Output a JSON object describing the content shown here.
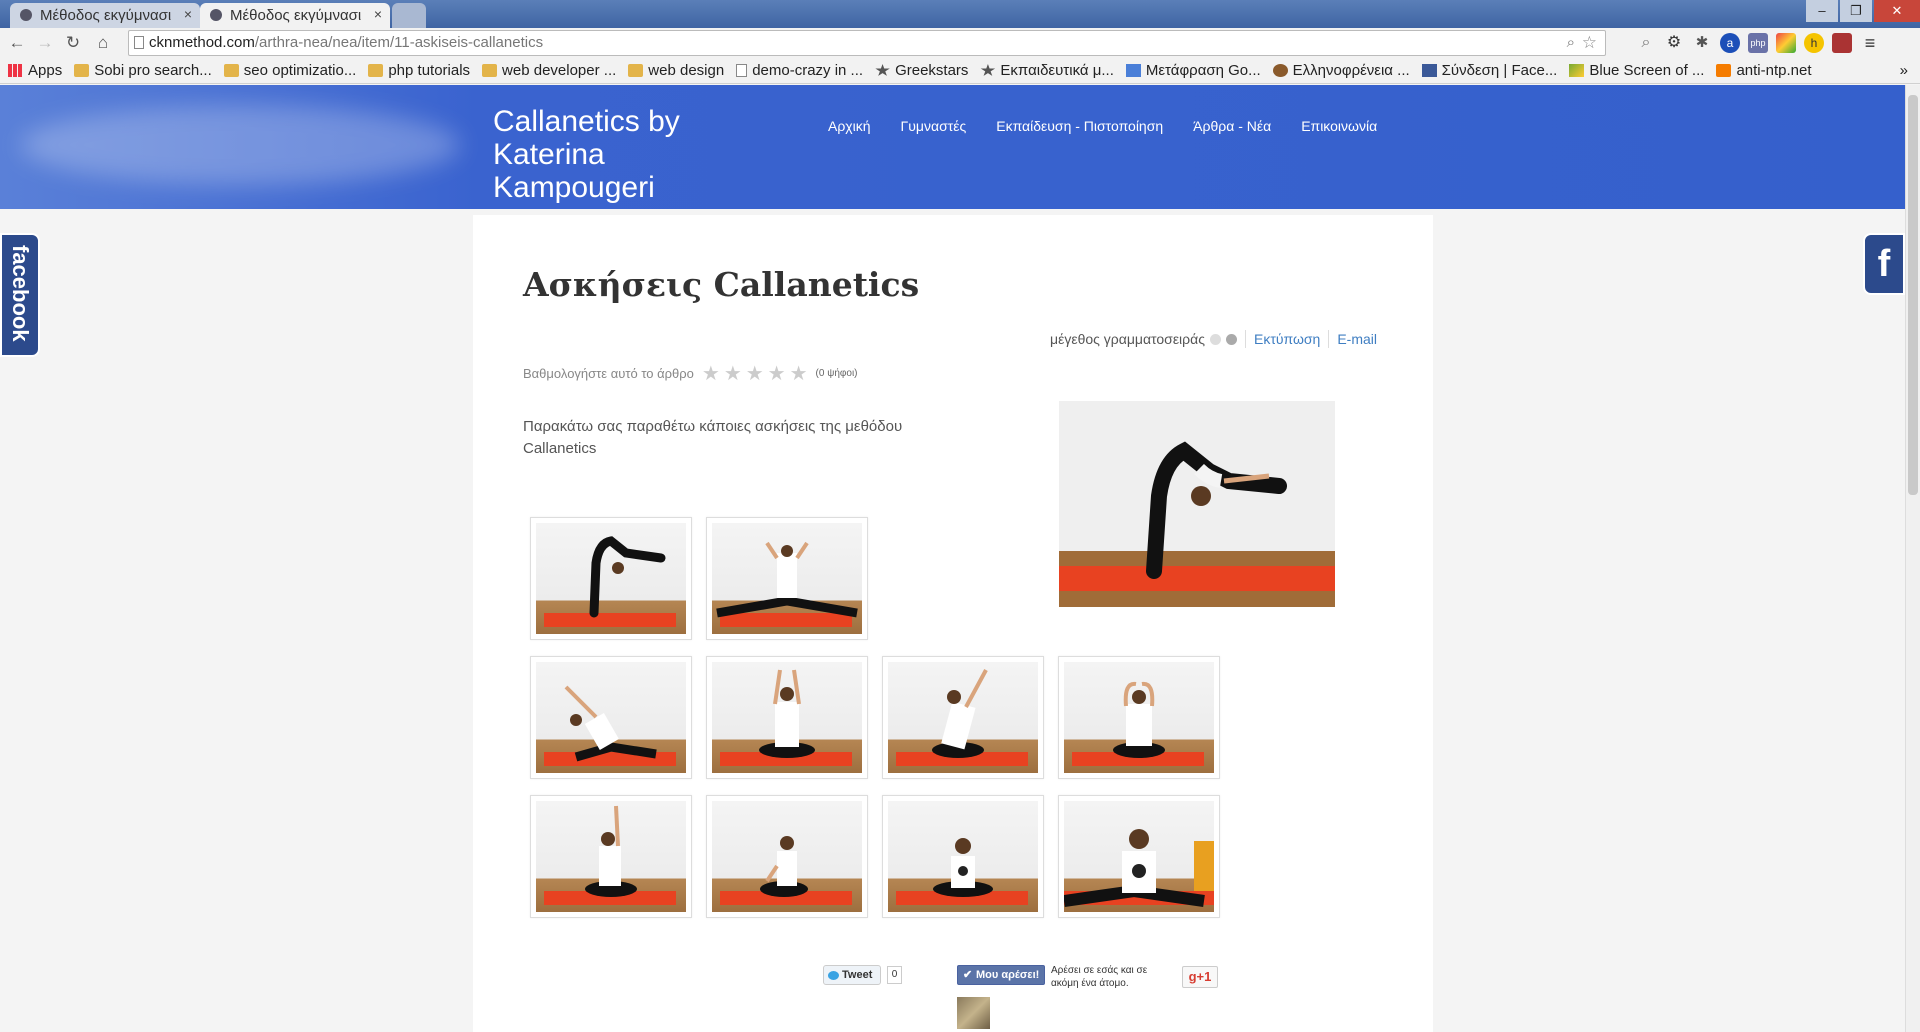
{
  "browser": {
    "tabs": [
      {
        "title": "Μέθοδος εκγύμνασι",
        "active": false
      },
      {
        "title": "Μέθοδος εκγύμνασι",
        "active": true
      }
    ],
    "window_controls": [
      "–",
      "❐",
      "✕"
    ],
    "url_domain": "cknmethod.com",
    "url_path": "/arthra-nea/nea/item/11-askiseis-callanetics",
    "bookmarks": [
      {
        "label": "Apps",
        "type": "apps"
      },
      {
        "label": "Sobi pro search...",
        "type": "folder"
      },
      {
        "label": "seo optimizatio...",
        "type": "folder"
      },
      {
        "label": "php tutorials",
        "type": "folder"
      },
      {
        "label": "web developer ...",
        "type": "folder"
      },
      {
        "label": "web design",
        "type": "folder"
      },
      {
        "label": "demo-crazy in ...",
        "type": "page"
      },
      {
        "label": "Greekstars",
        "type": "star"
      },
      {
        "label": "Εκπαιδευτικά μ...",
        "type": "star"
      },
      {
        "label": "Μετάφραση Go...",
        "type": "translate"
      },
      {
        "label": "Ελληνοφρένεια ...",
        "type": "site"
      },
      {
        "label": "Σύνδεση | Face...",
        "type": "facebook"
      },
      {
        "label": "Blue Screen of ...",
        "type": "site"
      },
      {
        "label": "anti-ntp.net",
        "type": "blogger"
      }
    ],
    "overflow": "»"
  },
  "site": {
    "title": "Callanetics by Katerina Kampougeri",
    "nav": [
      "Αρχική",
      "Γυμναστές",
      "Εκπαίδευση - Πιστοποίηση",
      "Άρθρα - Νέα",
      "Επικοινωνία"
    ],
    "facebook_side": "facebook",
    "facebook_icon": "f"
  },
  "article": {
    "title": "Ασκήσεις Callanetics",
    "font_size_label": "μέγεθος γραμματοσειράς",
    "print_label": "Εκτύπωση",
    "email_label": "E-mail",
    "rate_label": "Βαθμολογήστε αυτό το άρθρο",
    "rating_stars": 0,
    "votes_label": "(0 ψήφοι)",
    "intro": "Παρακάτω σας παραθέτω κάποιες ασκήσεις της μεθόδου Callanetics",
    "gallery_count": 10
  },
  "social": {
    "tweet_label": "Tweet",
    "tweet_count": "0",
    "like_label": "Μου αρέσει!",
    "like_text": "Αρέσει σε εσάς και σε ακόμη ένα άτομο.",
    "gplus_label": "g+1"
  },
  "colors": {
    "header_blue": "#3560cc",
    "link_blue": "#3f7ec2",
    "facebook_blue": "#2c4a8c",
    "mat_red": "#e84221"
  }
}
